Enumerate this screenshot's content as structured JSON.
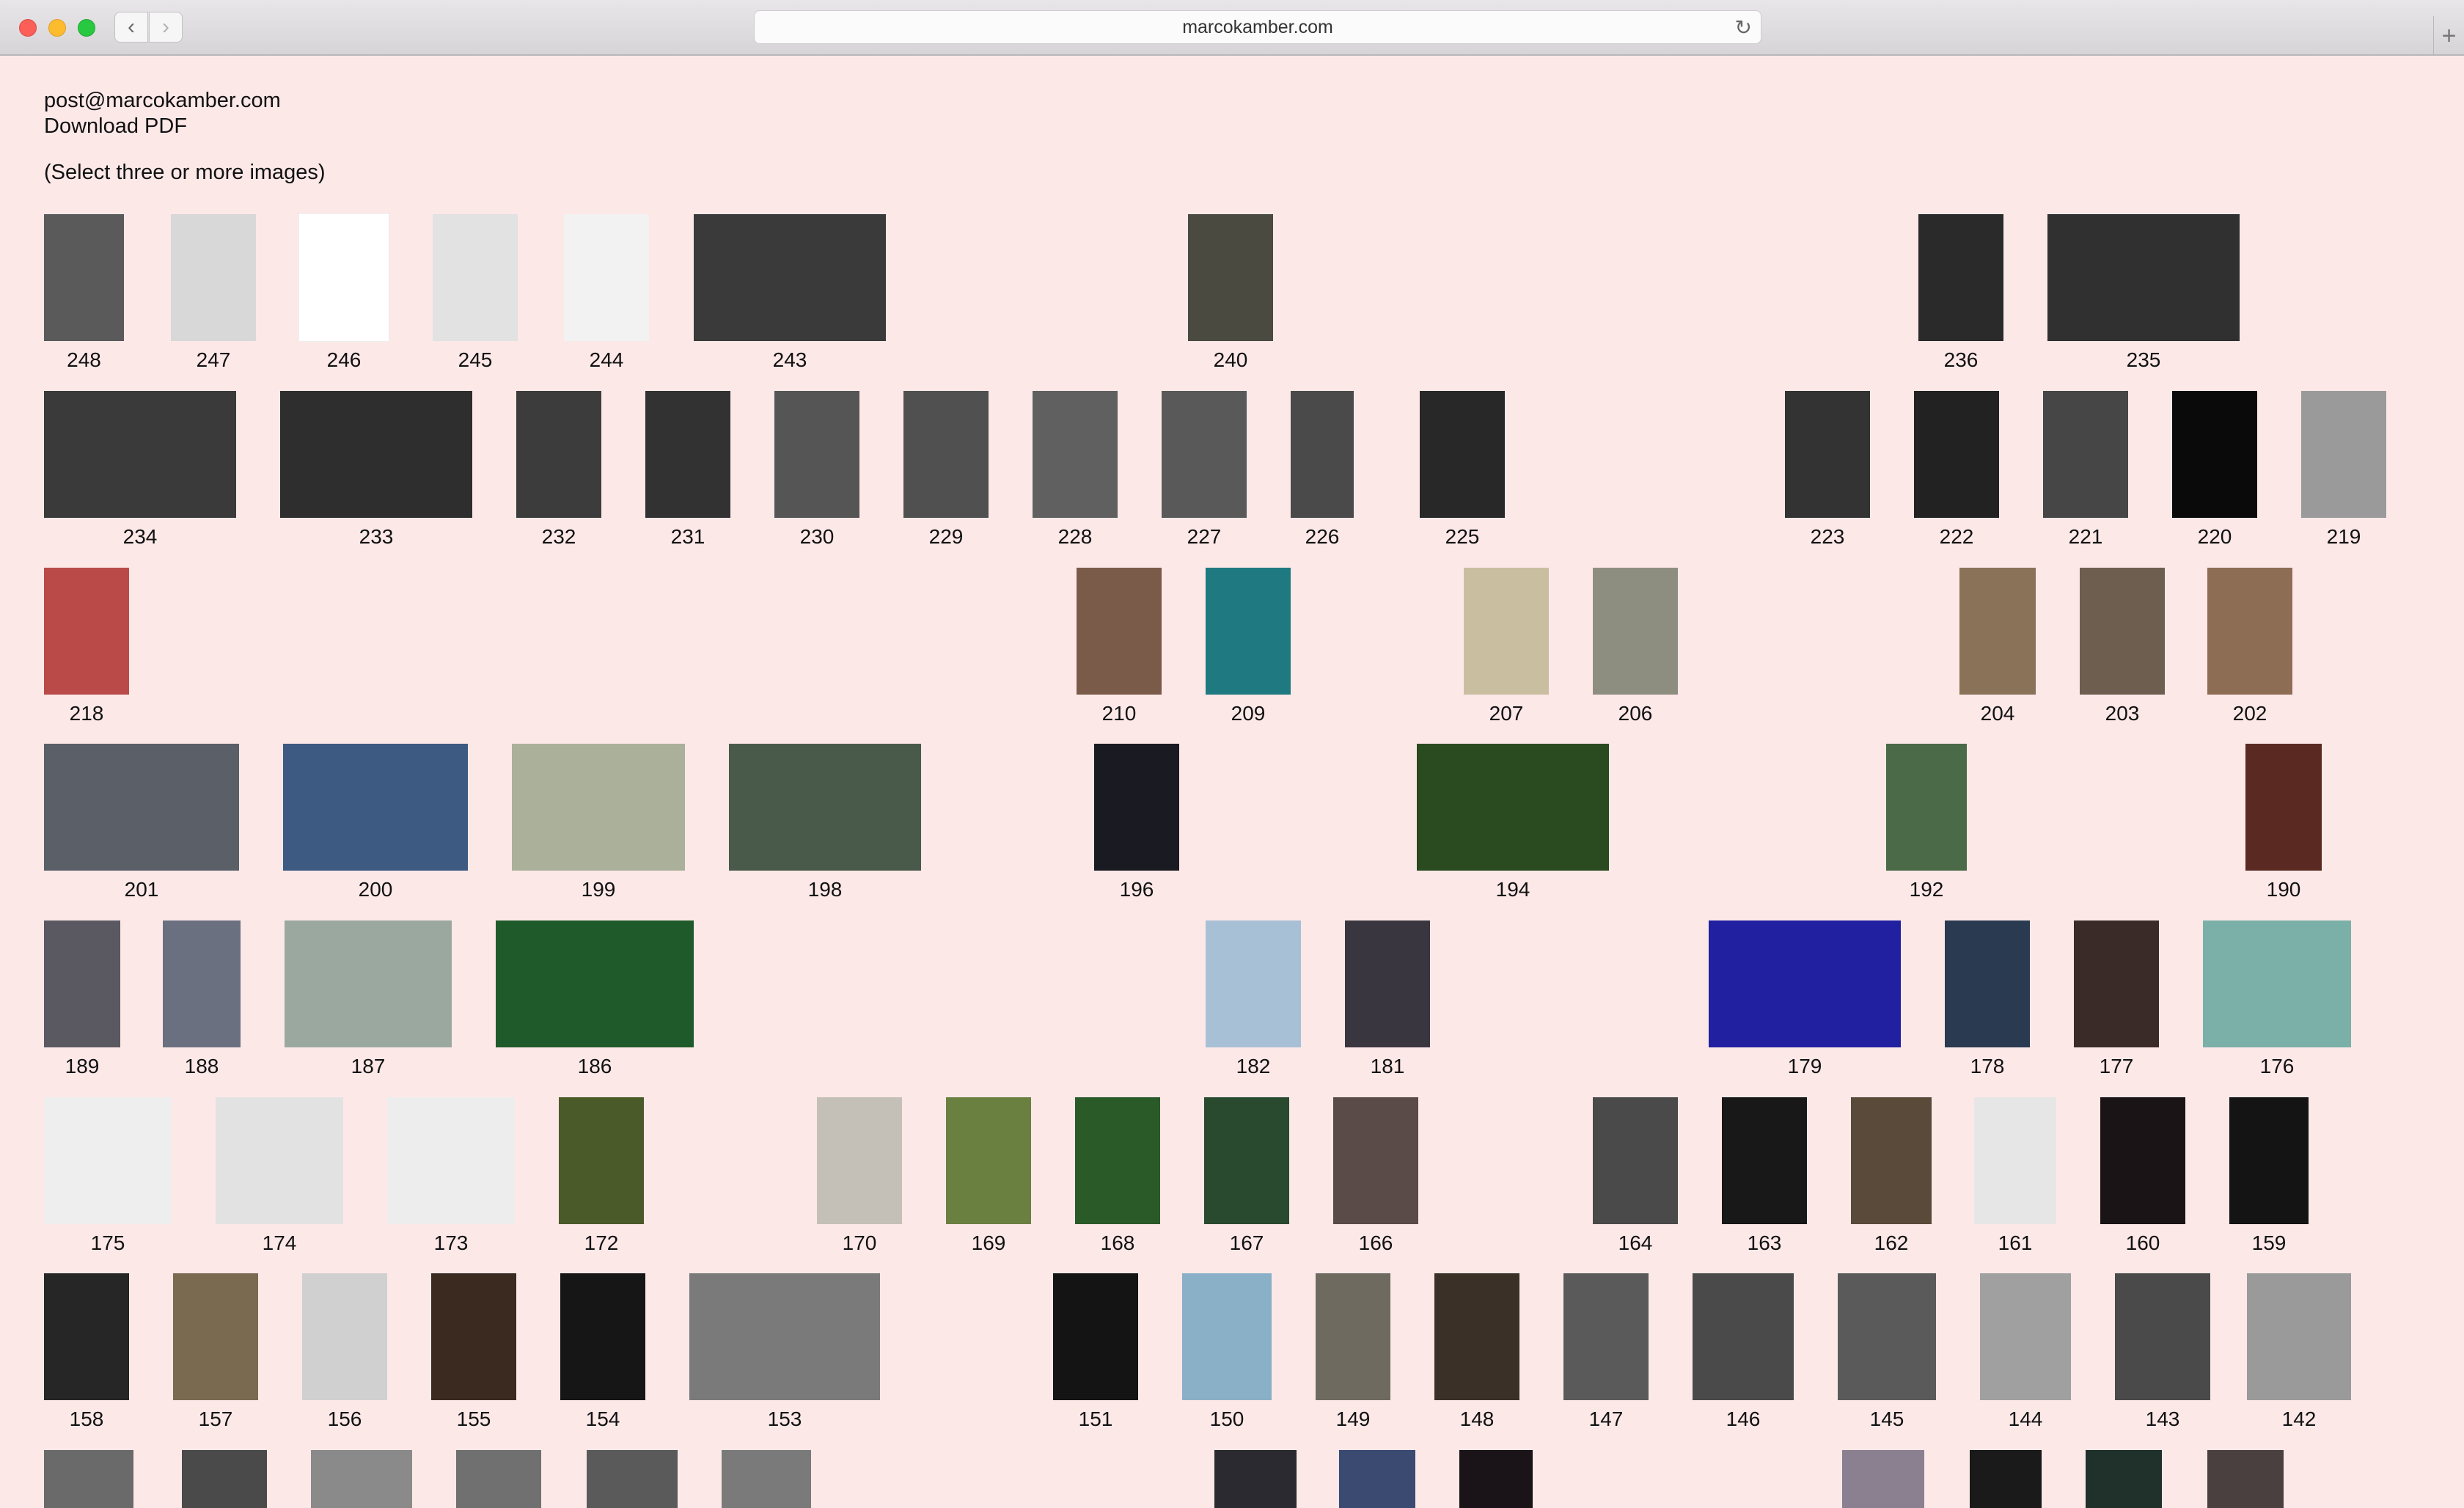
{
  "browser": {
    "url": "marcokamber.com",
    "back_glyph": "‹",
    "forward_glyph": "›",
    "reload_glyph": "↻",
    "newtab_glyph": "+",
    "traffic_lights": [
      "#fc5f57",
      "#fdbc2e",
      "#28c840"
    ]
  },
  "header": {
    "email": "post@marcokamber.com",
    "download": "Download PDF",
    "instruction": "(Select three or more images)"
  },
  "colors": {
    "background": "#fde8e8",
    "text": "#111111"
  },
  "images": [
    {
      "n": "248",
      "c": "#5a5a5a"
    },
    {
      "n": "247",
      "c": "#d8d8d8"
    },
    {
      "n": "246",
      "c": "#ffffff"
    },
    {
      "n": "245",
      "c": "#e2e2e2"
    },
    {
      "n": "244",
      "c": "#f2f2f2"
    },
    {
      "n": "243",
      "c": "#3a3a3a"
    },
    {
      "n": "240",
      "c": "#4a4a40"
    },
    {
      "n": "236",
      "c": "#2a2a2a"
    },
    {
      "n": "235",
      "c": "#303030"
    },
    {
      "n": "234",
      "c": "#3a3a3a"
    },
    {
      "n": "233",
      "c": "#2e2e2e"
    },
    {
      "n": "232",
      "c": "#3c3c3c"
    },
    {
      "n": "231",
      "c": "#323232"
    },
    {
      "n": "230",
      "c": "#555555"
    },
    {
      "n": "229",
      "c": "#505050"
    },
    {
      "n": "228",
      "c": "#606060"
    },
    {
      "n": "227",
      "c": "#595959"
    },
    {
      "n": "226",
      "c": "#4a4a4a"
    },
    {
      "n": "225",
      "c": "#282828"
    },
    {
      "n": "223",
      "c": "#333333"
    },
    {
      "n": "222",
      "c": "#222222"
    },
    {
      "n": "221",
      "c": "#464646"
    },
    {
      "n": "220",
      "c": "#0a0a0a"
    },
    {
      "n": "219",
      "c": "#9a9a9a"
    },
    {
      "n": "218",
      "c": "#b94a48"
    },
    {
      "n": "210",
      "c": "#7a5a48"
    },
    {
      "n": "209",
      "c": "#1e7a80"
    },
    {
      "n": "207",
      "c": "#c9bfa0"
    },
    {
      "n": "206",
      "c": "#8e8e80"
    },
    {
      "n": "204",
      "c": "#8a7258"
    },
    {
      "n": "203",
      "c": "#6e5e50"
    },
    {
      "n": "202",
      "c": "#8e6d55"
    },
    {
      "n": "201",
      "c": "#5a5f68"
    },
    {
      "n": "200",
      "c": "#3d5a82"
    },
    {
      "n": "199",
      "c": "#aab09a"
    },
    {
      "n": "198",
      "c": "#4a5a4a"
    },
    {
      "n": "196",
      "c": "#1a1a22"
    },
    {
      "n": "194",
      "c": "#2a4a20"
    },
    {
      "n": "192",
      "c": "#4a6a48"
    },
    {
      "n": "190",
      "c": "#5a2a22"
    },
    {
      "n": "189",
      "c": "#5a5860"
    },
    {
      "n": "188",
      "c": "#6a7080"
    },
    {
      "n": "187",
      "c": "#9aa8a0"
    },
    {
      "n": "186",
      "c": "#1f5a2a"
    },
    {
      "n": "182",
      "c": "#a7c0d6"
    },
    {
      "n": "181",
      "c": "#3a3640"
    },
    {
      "n": "179",
      "c": "#2020a0"
    },
    {
      "n": "178",
      "c": "#2a3a50"
    },
    {
      "n": "177",
      "c": "#3a2a28"
    },
    {
      "n": "176",
      "c": "#7ab0a8"
    },
    {
      "n": "175",
      "c": "#eeeeee"
    },
    {
      "n": "174",
      "c": "#e2e2e2"
    },
    {
      "n": "173",
      "c": "#ededed"
    },
    {
      "n": "172",
      "c": "#4a5a28"
    },
    {
      "n": "170",
      "c": "#c4c0b8"
    },
    {
      "n": "169",
      "c": "#6a8040"
    },
    {
      "n": "168",
      "c": "#2a5a28"
    },
    {
      "n": "167",
      "c": "#2a4a30"
    },
    {
      "n": "166",
      "c": "#5a4a48"
    },
    {
      "n": "164",
      "c": "#4a4a4a"
    },
    {
      "n": "163",
      "c": "#181818"
    },
    {
      "n": "162",
      "c": "#5a4a3a"
    },
    {
      "n": "161",
      "c": "#e6e6e6"
    },
    {
      "n": "160",
      "c": "#1a1416"
    },
    {
      "n": "159",
      "c": "#141414"
    },
    {
      "n": "158",
      "c": "#262626"
    },
    {
      "n": "157",
      "c": "#7a6a50"
    },
    {
      "n": "156",
      "c": "#d0d0d0"
    },
    {
      "n": "155",
      "c": "#3a2a20"
    },
    {
      "n": "154",
      "c": "#161616"
    },
    {
      "n": "153",
      "c": "#7a7a7a"
    },
    {
      "n": "151",
      "c": "#141414"
    },
    {
      "n": "150",
      "c": "#8ab0c8"
    },
    {
      "n": "149",
      "c": "#6e6a60"
    },
    {
      "n": "148",
      "c": "#3a3028"
    },
    {
      "n": "147",
      "c": "#5a5a5a"
    },
    {
      "n": "146",
      "c": "#4a4a4a"
    },
    {
      "n": "145",
      "c": "#5a5a5a"
    },
    {
      "n": "144",
      "c": "#a0a0a0"
    },
    {
      "n": "143",
      "c": "#4a4a4a"
    },
    {
      "n": "142",
      "c": "#9a9a9a"
    }
  ],
  "partial_row": [
    {
      "c": "#6a6a6a"
    },
    {
      "c": "#4a4a4a"
    },
    {
      "c": "#8a8a8a"
    },
    {
      "c": "#707070"
    },
    {
      "c": "#5a5a5a"
    },
    {
      "c": "#7a7a7a"
    },
    {
      "c": "#2a2a30"
    },
    {
      "c": "#3a4a70"
    },
    {
      "c": "#1a1418"
    },
    {
      "c": "#8a8090"
    },
    {
      "c": "#1a1a1a"
    },
    {
      "c": "#20302a"
    },
    {
      "c": "#4a4040"
    }
  ]
}
